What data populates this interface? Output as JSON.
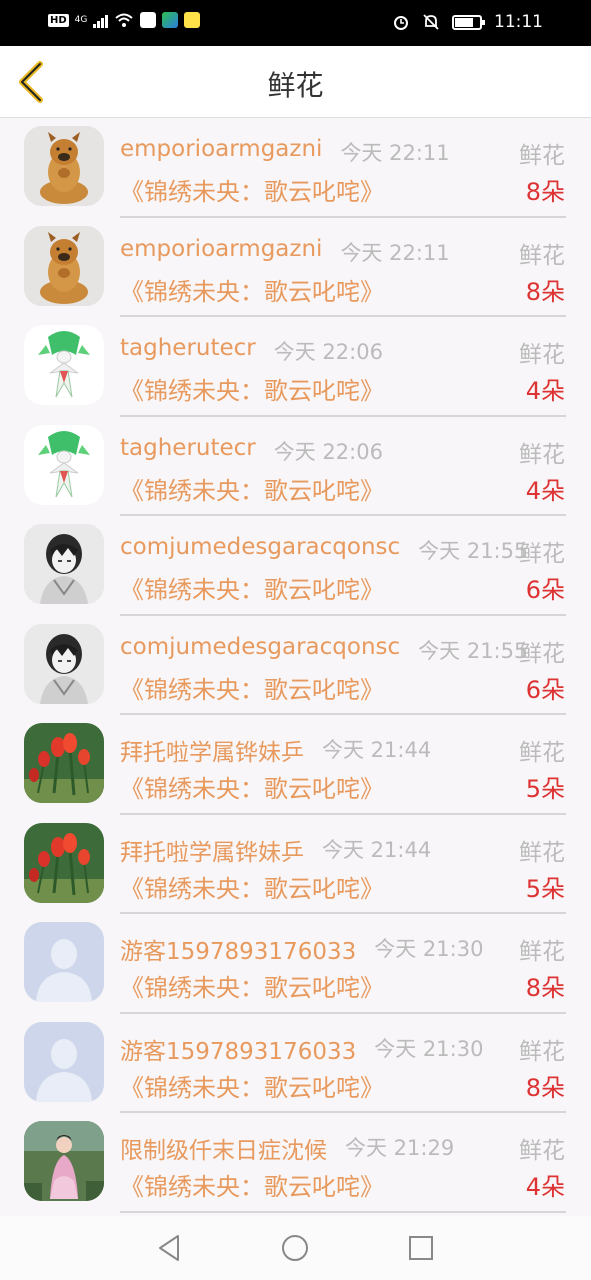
{
  "status_bar": {
    "left_badge": "HD",
    "network": "4G",
    "time": "11:11",
    "battery_level": 0.75
  },
  "header": {
    "title": "鲜花",
    "back_icon": "chevron-left-icon"
  },
  "rows": [
    {
      "name": "emporioarmgazni",
      "time": "今天 22:11",
      "gift": "鲜花",
      "title": "《锦绣未央：歌云叱咤》",
      "count": "8朵",
      "avatar": "dog-avatar"
    },
    {
      "name": "emporioarmgazni",
      "time": "今天 22:11",
      "gift": "鲜花",
      "title": "《锦绣未央：歌云叱咤》",
      "count": "8朵",
      "avatar": "dog-avatar"
    },
    {
      "name": "tagherutecr",
      "time": "今天 22:06",
      "gift": "鲜花",
      "title": "《锦绣未央：歌云叱咤》",
      "count": "4朵",
      "avatar": "character-avatar"
    },
    {
      "name": "tagherutecr",
      "time": "今天 22:06",
      "gift": "鲜花",
      "title": "《锦绣未央：歌云叱咤》",
      "count": "4朵",
      "avatar": "character-avatar"
    },
    {
      "name": "comjumedesgaracqonsc",
      "time": "今天 21:55",
      "gift": "鲜花",
      "title": "《锦绣未央：歌云叱咤》",
      "count": "6朵",
      "avatar": "anime-avatar"
    },
    {
      "name": "comjumedesgaracqonsc",
      "time": "今天 21:55",
      "gift": "鲜花",
      "title": "《锦绣未央：歌云叱咤》",
      "count": "6朵",
      "avatar": "anime-avatar"
    },
    {
      "name": "拜托啦学属铧妹乒",
      "time": "今天 21:44",
      "gift": "鲜花",
      "title": "《锦绣未央：歌云叱咤》",
      "count": "5朵",
      "avatar": "flower-avatar"
    },
    {
      "name": "拜托啦学属铧妹乒",
      "time": "今天 21:44",
      "gift": "鲜花",
      "title": "《锦绣未央：歌云叱咤》",
      "count": "5朵",
      "avatar": "flower-avatar"
    },
    {
      "name": "游客1597893176033",
      "time": "今天 21:30",
      "gift": "鲜花",
      "title": "《锦绣未央：歌云叱咤》",
      "count": "8朵",
      "avatar": "default-avatar"
    },
    {
      "name": "游客1597893176033",
      "time": "今天 21:30",
      "gift": "鲜花",
      "title": "《锦绣未央：歌云叱咤》",
      "count": "8朵",
      "avatar": "default-avatar"
    },
    {
      "name": "限制级仟末日症沈候",
      "time": "今天 21:29",
      "gift": "鲜花",
      "title": "《锦绣未央：歌云叱咤》",
      "count": "4朵",
      "avatar": "photo-avatar"
    }
  ],
  "nav": {
    "back": "triangle-back-icon",
    "home": "circle-home-icon",
    "recents": "square-recents-icon"
  }
}
